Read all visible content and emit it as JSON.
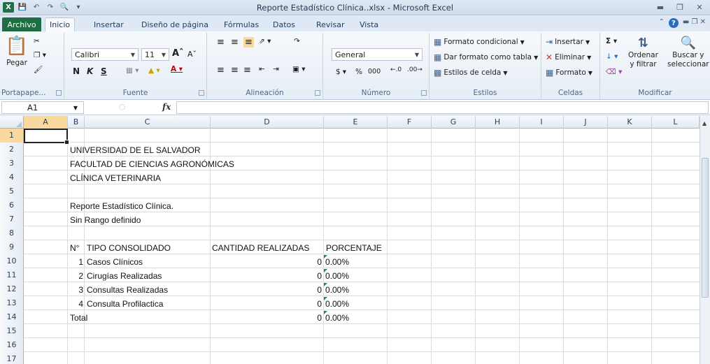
{
  "window": {
    "title": "Reporte Estadístico Clínica..xlsx - Microsoft Excel"
  },
  "ribbon_tabs": [
    "Archivo",
    "Inicio",
    "Insertar",
    "Diseño de página",
    "Fórmulas",
    "Datos",
    "Revisar",
    "Vista"
  ],
  "ribbon": {
    "clipboard": {
      "paste": "Pegar",
      "label": "Portapape..."
    },
    "font": {
      "name": "Calibri",
      "size": "11",
      "bold": "N",
      "italic": "K",
      "underline": "S",
      "label": "Fuente"
    },
    "alignment": {
      "label": "Alineación"
    },
    "number": {
      "format": "General",
      "currency": "$",
      "percent": "%",
      "thousands": "000",
      "label": "Número"
    },
    "styles": {
      "conditional": "Formato condicional",
      "as_table": "Dar formato como tabla",
      "cell_styles": "Estilos de celda",
      "label": "Estilos"
    },
    "cells": {
      "insert": "Insertar",
      "delete": "Eliminar",
      "format": "Formato",
      "label": "Celdas"
    },
    "editing": {
      "sort": "Ordenar",
      "sort2": "y filtrar",
      "find": "Buscar y",
      "find2": "seleccionar",
      "label": "Modificar"
    }
  },
  "formula_bar": {
    "name_box": "A1",
    "fx": "fx",
    "value": ""
  },
  "columns": [
    "A",
    "B",
    "C",
    "D",
    "E",
    "F",
    "G",
    "H",
    "I",
    "J",
    "K",
    "L"
  ],
  "rows": [
    "1",
    "2",
    "3",
    "4",
    "5",
    "6",
    "7",
    "8",
    "9",
    "10",
    "11",
    "12",
    "13",
    "14",
    "15",
    "16",
    "17"
  ],
  "sheet": {
    "r2": "UNIVERSIDAD DE EL SALVADOR",
    "r3": "FACULTAD DE CIENCIAS AGRONÓMICAS",
    "r4": "CLÍNICA VETERINARIA",
    "r6": "Reporte Estadístico Clínica.",
    "r7": "Sin Rango definido",
    "header": {
      "n": "N°",
      "tipo": "TIPO CONSOLIDADO",
      "cantidad": "CANTIDAD REALIZADAS",
      "porcentaje": "PORCENTAJE"
    },
    "items": [
      {
        "n": "1",
        "tipo": "Casos Clínicos",
        "cantidad": "0",
        "porcentaje": "0.00%"
      },
      {
        "n": "2",
        "tipo": "Cirugías Realizadas",
        "cantidad": "0",
        "porcentaje": "0.00%"
      },
      {
        "n": "3",
        "tipo": "Consultas Realizadas",
        "cantidad": "0",
        "porcentaje": "0.00%"
      },
      {
        "n": "4",
        "tipo": "Consulta Profilactica",
        "cantidad": "0",
        "porcentaje": "0.00%"
      }
    ],
    "total": {
      "label": "Total",
      "cantidad": "0",
      "porcentaje": "0.00%"
    }
  }
}
